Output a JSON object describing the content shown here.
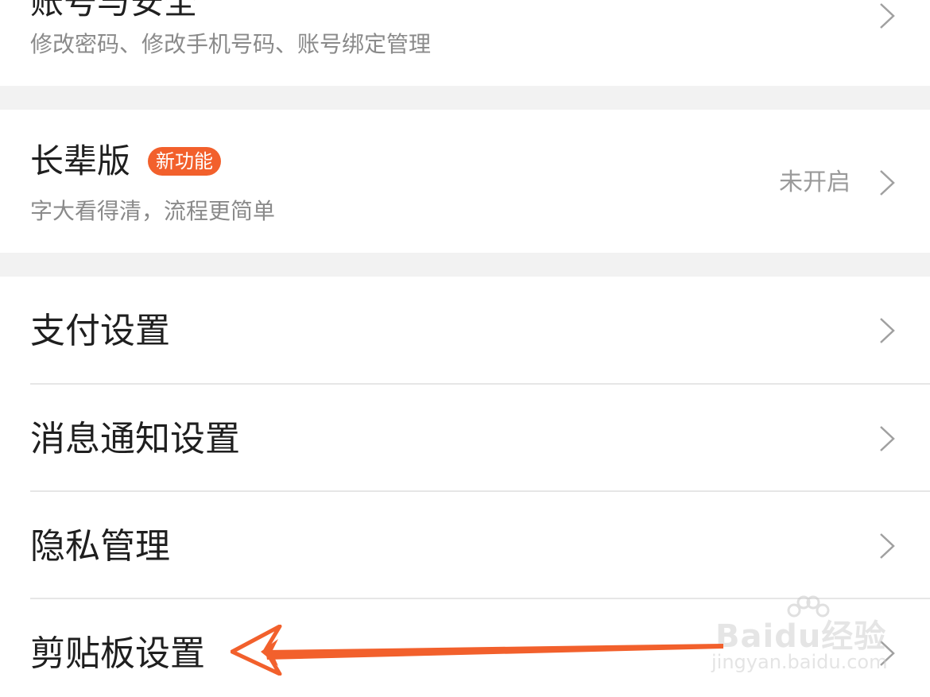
{
  "colors": {
    "accent": "#f2602c",
    "gap": "#f2f2f2",
    "chevron": "#a0a0a0"
  },
  "account_security": {
    "title": "账号与安全",
    "subtitle": "修改密码、修改手机号码、账号绑定管理"
  },
  "elder_mode": {
    "title": "长辈版",
    "badge": "新功能",
    "subtitle": "字大看得清，流程更简单",
    "status": "未开启"
  },
  "settings_items": [
    {
      "label": "支付设置"
    },
    {
      "label": "消息通知设置"
    },
    {
      "label": "隐私管理"
    },
    {
      "label": "剪贴板设置"
    }
  ],
  "watermark": {
    "logo": "Baidu经验",
    "url": "jingyan.baidu.com"
  }
}
